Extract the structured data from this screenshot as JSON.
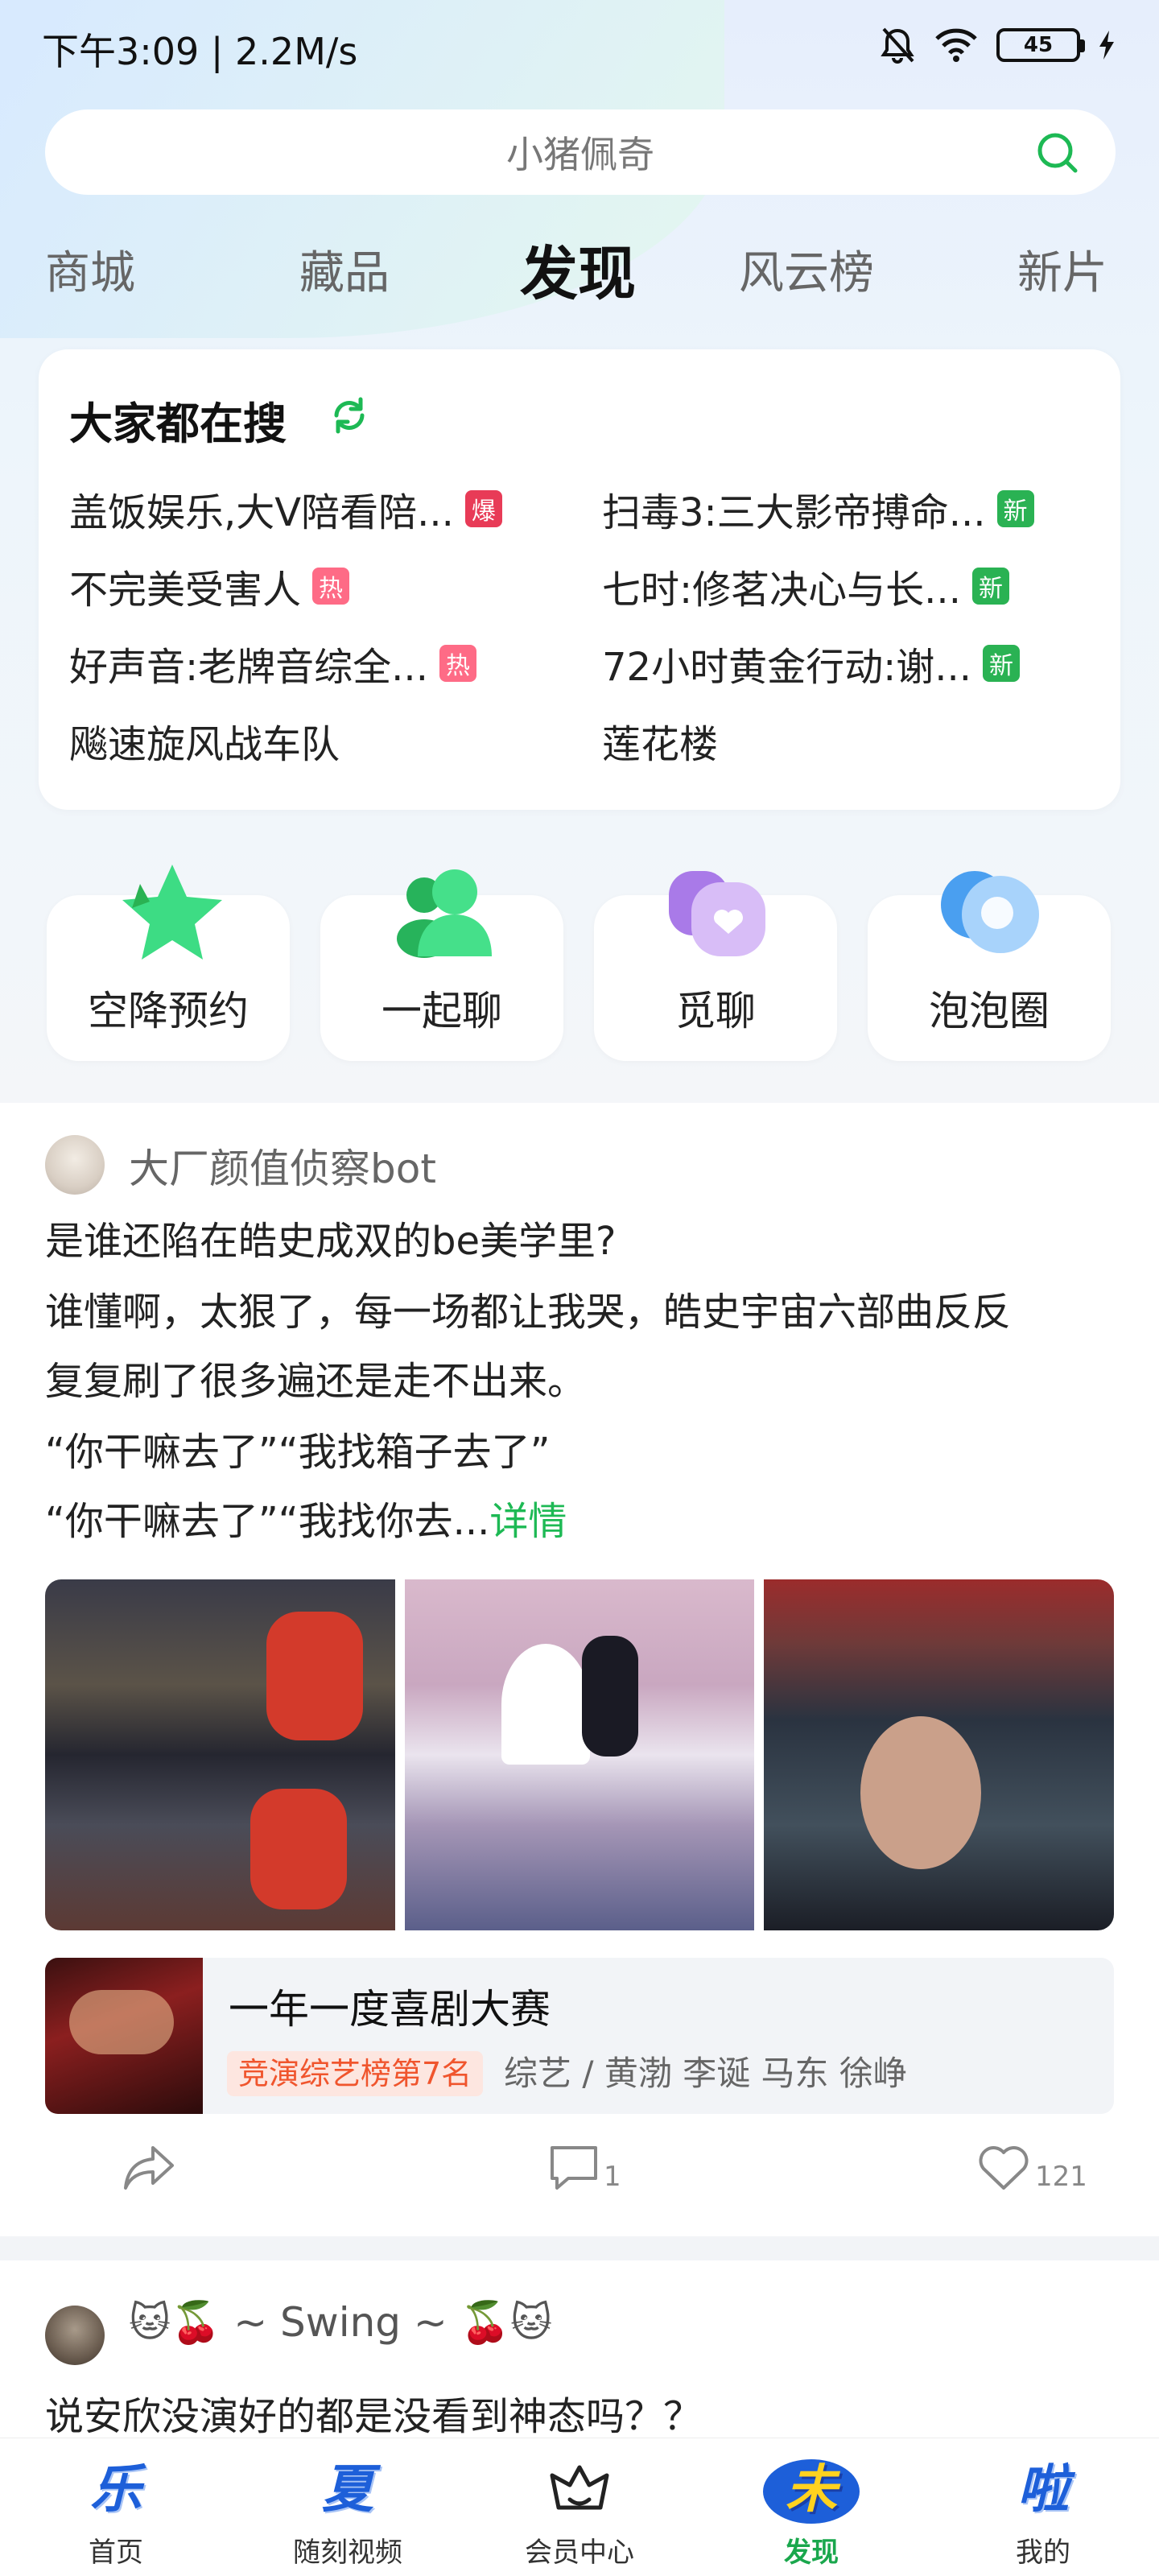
{
  "status_bar": {
    "time": "下午3:09 | 2.2M/s",
    "battery": "45"
  },
  "search": {
    "placeholder": "小猪佩奇"
  },
  "tabs": [
    {
      "label": "商城"
    },
    {
      "label": "藏品"
    },
    {
      "label": "发现",
      "active": true
    },
    {
      "label": "风云榜"
    },
    {
      "label": "新片"
    }
  ],
  "hot_search": {
    "title": "大家都在搜",
    "items": [
      {
        "text": "盖饭娱乐,大V陪看陪...",
        "badge": "爆"
      },
      {
        "text": "扫毒3:三大影帝搏命...",
        "badge": "新"
      },
      {
        "text": "不完美受害人",
        "badge": "热"
      },
      {
        "text": "七时:修茗决心与长...",
        "badge": "新"
      },
      {
        "text": "好声音:老牌音综全...",
        "badge": "热"
      },
      {
        "text": "72小时黄金行动:谢...",
        "badge": "新"
      },
      {
        "text": "飚速旋风战车队",
        "badge": ""
      },
      {
        "text": "莲花楼",
        "badge": ""
      }
    ]
  },
  "features": [
    {
      "label": "空降预约",
      "icon": "star-icon"
    },
    {
      "label": "一起聊",
      "icon": "people-icon"
    },
    {
      "label": "觅聊",
      "icon": "heart-chat-icon"
    },
    {
      "label": "泡泡圈",
      "icon": "bubble-icon"
    }
  ],
  "post": {
    "author": "大厂颜值侦察bot",
    "lines": [
      "是谁还陷在皓史成双的be美学里?",
      "谁懂啊，太狠了，每一场都让我哭，皓史宇宙六部曲反反",
      "复复刷了很多遍还是走不出来。",
      "“你干嘛去了”“我找箱子去了”",
      "“你干嘛去了”“我找你去..."
    ],
    "more_label": "详情",
    "work": {
      "title": "一年一度喜剧大赛",
      "rank": "竞演综艺榜第7名",
      "meta": "综艺 / 黄渤 李诞 马东 徐峥"
    },
    "actions": {
      "comments": "1",
      "likes": "121"
    }
  },
  "post2": {
    "author": "🐱🍒 ~ Swing ~ 🍒🐱",
    "text": "说安欣没演好的都是没看到神态吗？？"
  },
  "bottom_nav": [
    {
      "label": "首页",
      "glyph": "乐"
    },
    {
      "label": "随刻视频",
      "glyph": "夏"
    },
    {
      "label": "会员中心",
      "glyph": ""
    },
    {
      "label": "发现",
      "glyph": "未",
      "active": true
    },
    {
      "label": "我的",
      "glyph": "啦"
    }
  ],
  "colors": {
    "accent_green": "#1db954",
    "badge_red": "#e83b57",
    "badge_pink": "#fe6b86",
    "badge_green": "#2ab253",
    "nav_blue": "#1d5fd9"
  }
}
